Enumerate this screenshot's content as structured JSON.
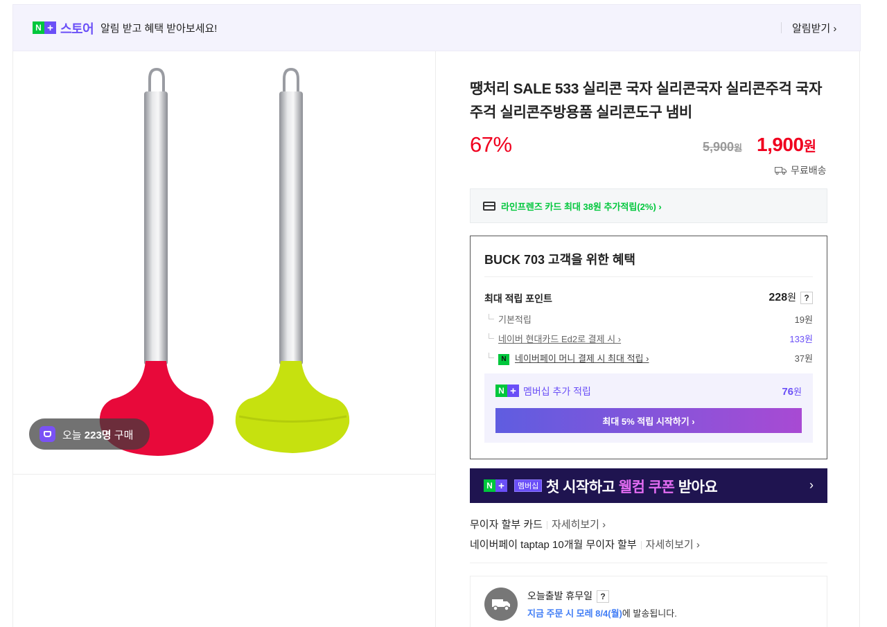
{
  "banner": {
    "logo_n": "N",
    "logo_plus": "+",
    "store": "스토어",
    "message": "알림 받고 혜택 받아보세요!",
    "alarm": "알림받기 ›"
  },
  "gallery": {
    "buy_today": "오늘 223명 구매",
    "buy_prefix": "오늘 ",
    "buy_count": "223명",
    "buy_suffix": " 구매"
  },
  "product": {
    "title": "땡처리 SALE 533 실리콘 국자 실리콘국자 실리콘주걱 국자 주걱 실리콘주방용품 실리콘도구 냄비",
    "discount": "67%",
    "original_price": "5,900",
    "original_unit": "원",
    "sale_price": "1,900",
    "sale_unit": "원",
    "shipping": "무료배송",
    "card_promo": "라인프렌즈 카드 최대 38원 추가적립(2%) ›"
  },
  "benefits": {
    "title": "BUCK 703 고객을 위한 혜택",
    "max_point_label": "최대 적립 포인트",
    "max_point_value": "228",
    "max_point_unit": "원",
    "help": "?",
    "rows": [
      {
        "label": "기본적립",
        "value": "19원"
      },
      {
        "label": "네이버 현대카드 Ed2로 결제 시 ›",
        "value": "133원"
      },
      {
        "label": "네이버페이 머니 결제 시 최대 적립 ›",
        "value": "37원"
      }
    ],
    "npay_icon": "N",
    "membership_label": "멤버십 추가 적립",
    "membership_value": "76",
    "membership_unit": "원",
    "cta": "최대 5% 적립 시작하기 ›"
  },
  "welcome": {
    "badge": "멤버십",
    "text_pre": "첫 시작하고 ",
    "text_em": "웰컴 쿠폰",
    "text_post": " 받아요",
    "arrow": "›"
  },
  "installments": [
    {
      "label": "무이자 할부 카드",
      "detail": "자세히보기 ›"
    },
    {
      "label": "네이버페이 taptap 10개월 무이자 할부",
      "detail": "자세히보기 ›"
    }
  ],
  "shipping_info": {
    "title": "오늘출발 휴무일",
    "help": "?",
    "notice_em": "지금 주문 시 모레 8/4(월)",
    "notice_rest": "에 발송됩니다."
  },
  "colors": {
    "accent_purple": "#6a4ff7",
    "sale_red": "#f0001e",
    "naver_green": "#00c73c",
    "welcome_bg": "#1f1450"
  },
  "icons": [
    "naver-plus-logo",
    "chevron-right-icon",
    "shopping-bag-icon",
    "truck-icon",
    "card-icon",
    "question-icon",
    "npay-icon"
  ]
}
